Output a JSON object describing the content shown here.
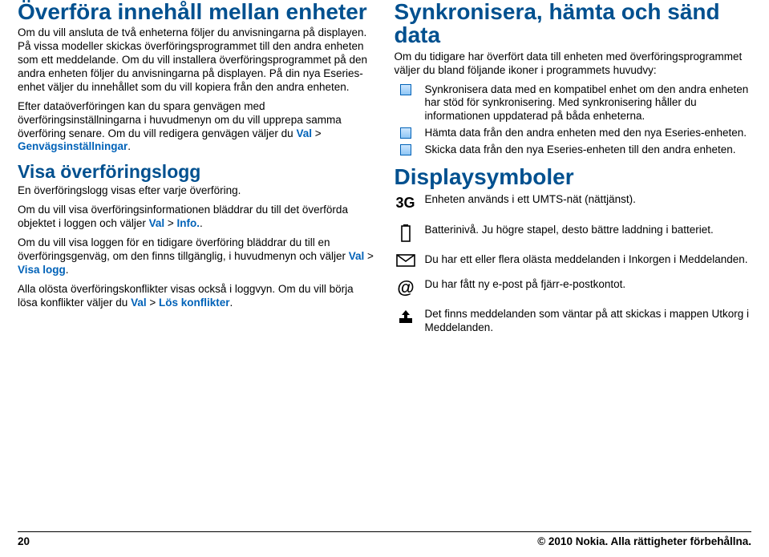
{
  "left": {
    "h1": "Överföra innehåll mellan enheter",
    "p1": "Om du vill ansluta de två enheterna följer du anvisningarna på displayen. På vissa modeller skickas överföringsprogrammet till den andra enheten som ett meddelande. Om du vill installera överföringsprogrammet på den andra enheten följer du anvisningarna på displayen. På din nya Eseries-enhet väljer du innehållet som du vill kopiera från den andra enheten.",
    "p2a": "Efter dataöverföringen kan du spara genvägen med överföringsinställningarna i huvudmenyn om du vill upprepa samma överföring senare. Om du vill redigera genvägen väljer du ",
    "p2_val": "Val",
    "p2_gt": " > ",
    "p2_genv": "Genvägsinställningar",
    "p2_end": ".",
    "h2": "Visa överföringslogg",
    "p3": "En överföringslogg visas efter varje överföring.",
    "p4a": "Om du vill visa överföringsinformationen bläddrar du till det överförda objektet i loggen och väljer ",
    "p4_val": "Val",
    "p4_gt": " > ",
    "p4_info": "Info.",
    "p4_end": ".",
    "p5a": "Om du vill visa loggen för en tidigare överföring bläddrar du till en överföringsgenväg, om den finns tillgänglig, i huvudmenyn och väljer ",
    "p5_val": "Val",
    "p5_gt": " > ",
    "p5_visa": "Visa logg",
    "p5_end": ".",
    "p6a": "Alla olösta överföringskonflikter visas också i loggvyn. Om du vill börja lösa konflikter väljer du ",
    "p6_val": "Val",
    "p6_gt": " > ",
    "p6_los": "Lös konflikter",
    "p6_end": "."
  },
  "right": {
    "h1": "Synkronisera, hämta och sänd data",
    "p1": "Om du tidigare har överfört data till enheten med överföringsprogrammet väljer du bland följande ikoner i programmets huvudvy:",
    "i1": "Synkronisera data med en kompatibel enhet om den andra enheten har stöd för synkronisering. Med synkronisering håller du informationen uppdaterad på båda enheterna.",
    "i2": "Hämta data från den andra enheten med den nya Eseries-enheten.",
    "i3": "Skicka data från den nya Eseries-enheten till den andra enheten.",
    "h2": "Displaysymboler",
    "s_3g": "3G",
    "d_3g": "Enheten används i ett UMTS-nät (nättjänst).",
    "d_batt": "Batterinivå. Ju högre stapel, desto bättre laddning i batteriet.",
    "d_mail": "Du har ett eller flera olästa meddelanden i Inkorgen i Meddelanden.",
    "d_at": "Du har fått ny e-post på fjärr-e-postkontot.",
    "d_out": "Det finns meddelanden som väntar på att skickas i mappen Utkorg i Meddelanden."
  },
  "footer": {
    "page": "20",
    "copy": "© 2010 Nokia. Alla rättigheter förbehållna."
  }
}
